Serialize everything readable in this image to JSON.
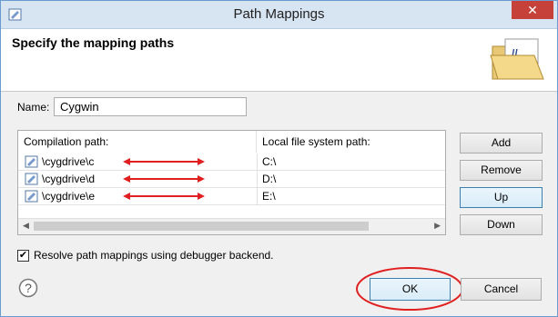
{
  "window": {
    "title": "Path Mappings",
    "close_label": "✕"
  },
  "header": {
    "title": "Specify the mapping paths",
    "icon": "open-folder-icon"
  },
  "name": {
    "label": "Name:",
    "value": "Cygwin"
  },
  "table": {
    "columns": [
      "Compilation path:",
      "Local file system path:"
    ],
    "rows": [
      {
        "compilation": "\\cygdrive\\c",
        "local": "C:\\"
      },
      {
        "compilation": "\\cygdrive\\d",
        "local": "D:\\"
      },
      {
        "compilation": "\\cygdrive\\e",
        "local": "E:\\"
      }
    ]
  },
  "buttons": {
    "add": "Add",
    "remove": "Remove",
    "up": "Up",
    "down": "Down",
    "ok": "OK",
    "cancel": "Cancel"
  },
  "options": {
    "resolve_label": "Resolve path mappings using debugger backend.",
    "resolve_checked": true,
    "check_mark": "✔"
  },
  "colors": {
    "annotation_red": "#e02020",
    "focus_blue": "#3c7fb1"
  }
}
